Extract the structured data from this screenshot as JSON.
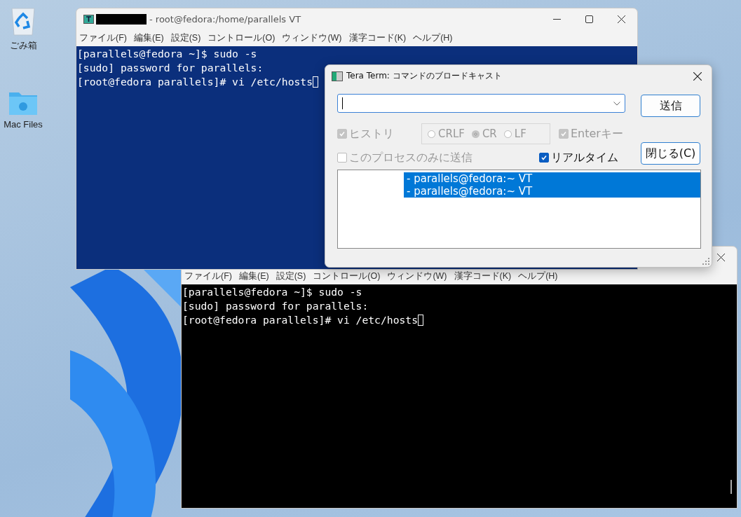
{
  "desktop_icons": [
    {
      "kind": "bin",
      "label": "ごみ箱"
    },
    {
      "kind": "folder",
      "label": "Mac Files"
    }
  ],
  "terminal_windows": [
    {
      "title": "- root@fedora:/home/parallels VT",
      "color": "#0b2f7c",
      "menu": [
        "ファイル(F)",
        "編集(E)",
        "設定(S)",
        "コントロール(O)",
        "ウィンドウ(W)",
        "漢字コード(K)",
        "ヘルプ(H)"
      ],
      "lines": [
        "[parallels@fedora ~]$ sudo -s",
        "[sudo] password for parallels:",
        "[root@fedora parallels]# vi /etc/hosts"
      ]
    },
    {
      "color": "#000000",
      "menu": [
        "ファイル(F)",
        "編集(E)",
        "設定(S)",
        "コントロール(O)",
        "ウィンドウ(W)",
        "漢字コード(K)",
        "ヘルプ(H)"
      ],
      "lines": [
        "[parallels@fedora ~]$ sudo -s",
        "[sudo] password for parallels:",
        "[root@fedora parallels]# vi /etc/hosts"
      ]
    }
  ],
  "dialog": {
    "title": "Tera Term: コマンドのブロードキャスト",
    "history": {
      "label": "ヒストリ",
      "checked": true,
      "disabled": true
    },
    "newline": [
      {
        "label": "CRLF",
        "selected": false,
        "disabled": true
      },
      {
        "label": "CR",
        "selected": true,
        "disabled": true
      },
      {
        "label": "LF",
        "selected": false,
        "disabled": true
      }
    ],
    "enter_key": {
      "label": "Enterキー",
      "checked": true,
      "disabled": true
    },
    "this_process_only": {
      "label": "このプロセスのみに送信",
      "checked": false,
      "disabled": true
    },
    "realtime": {
      "label": "リアルタイム",
      "checked": true,
      "disabled": false
    },
    "send_button": "送信",
    "close_button": "閉じる(C)",
    "windows": [
      {
        "text": "- parallels@fedora:~ VT",
        "selected": true
      },
      {
        "text": "- parallels@fedora:~ VT",
        "selected": true
      }
    ]
  }
}
